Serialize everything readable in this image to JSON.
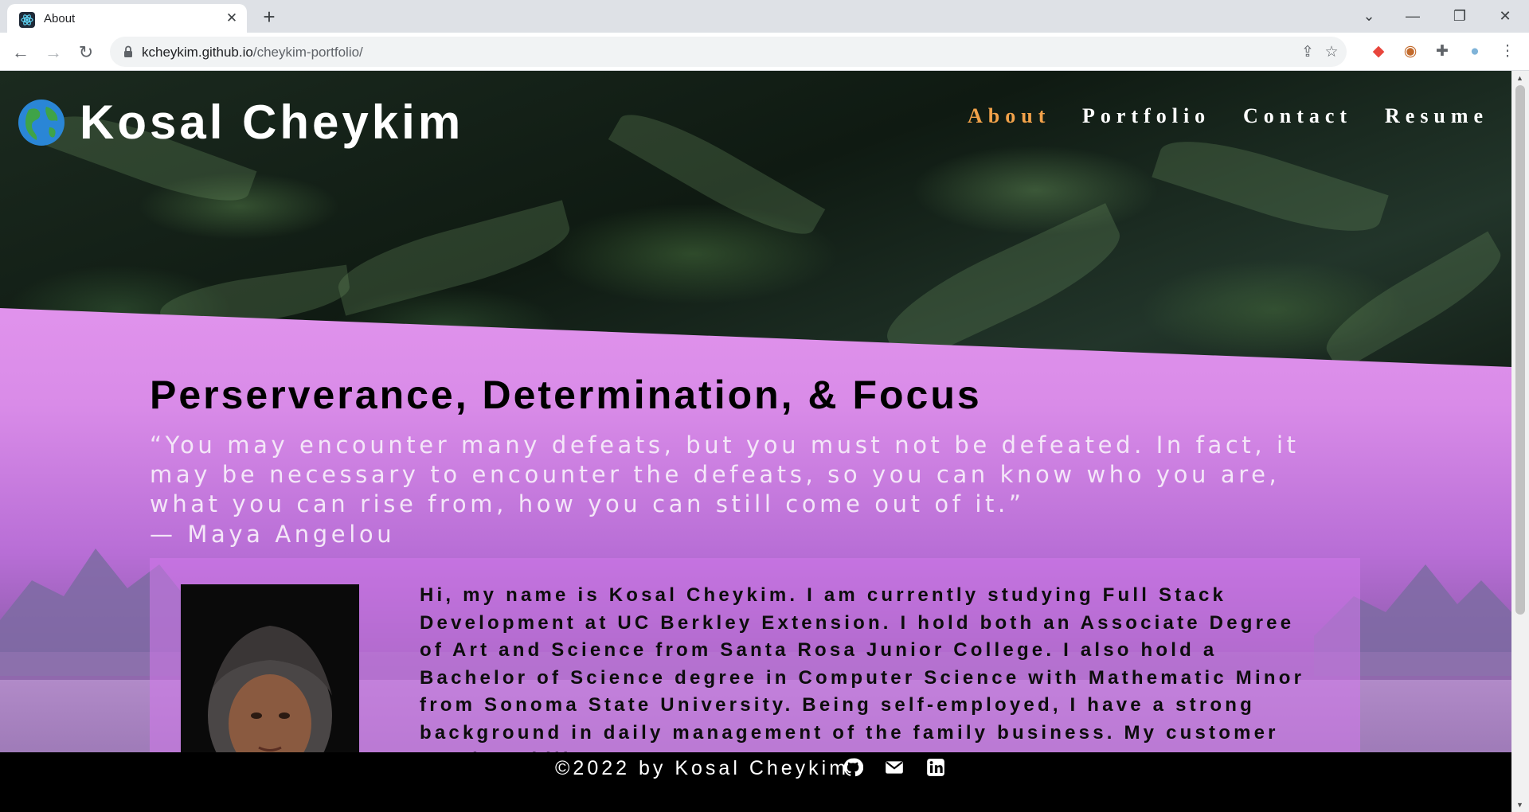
{
  "browser": {
    "tab_title": "About",
    "tab_close": "✕",
    "new_tab": "+",
    "url_domain": "kcheykim.github.io",
    "url_path": "/cheykim-portfolio/",
    "controls": {
      "minimize": "—",
      "restore": "❐",
      "close": "✕",
      "tab_search": "⌄"
    },
    "nav": {
      "back": "←",
      "forward": "→",
      "reload": "↻"
    },
    "omnibox_icons": {
      "share": "⇪",
      "bookmark": "☆"
    },
    "extensions": {
      "ext1": "◆",
      "ext2": "◉",
      "puzzle": "✚",
      "profile": "●",
      "menu": "⋮"
    }
  },
  "site": {
    "brand_name": "Kosal Cheykim",
    "nav": [
      "About",
      "Portfolio",
      "Contact",
      "Resume"
    ],
    "active_nav": "About",
    "accent_color": "#f2a24a",
    "headline": "Perserverance, Determination, & Focus",
    "quote": "“You may encounter many defeats, but you must not be defeated. In fact, it may be necessary to encounter the defeats, so you can know who you are, what you can rise from, how you can still come out of it.”",
    "quote_author": "— Maya Angelou",
    "bio": "Hi, my name is Kosal Cheykim. I am currently studying Full Stack Development at UC Berkley Extension. I hold both an Associate Degree of Art and Science from Santa Rosa Junior College. I also hold a Bachelor of Science degree in Computer Science with Mathematic Minor from Sonoma State University. Being self-employed, I have a strong background in daily management of the family business. My customer service skills are",
    "footer_text": "©2022 by Kosal Cheykim",
    "footer_icons": [
      "github-icon",
      "email-icon",
      "linkedin-icon"
    ]
  }
}
